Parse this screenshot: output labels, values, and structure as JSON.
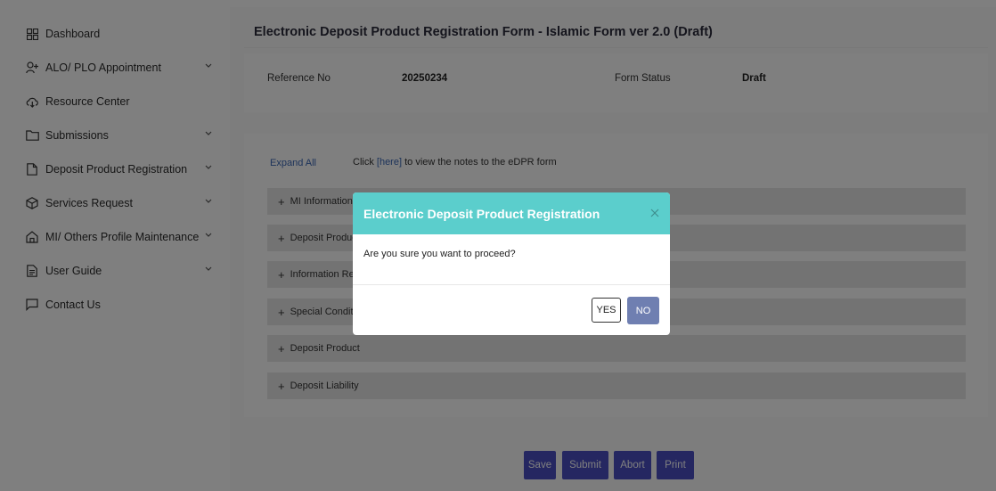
{
  "sidebar": {
    "items": [
      {
        "label": "Dashboard",
        "icon": "grid-icon",
        "has_chevron": false
      },
      {
        "label": "ALO/ PLO Appointment",
        "icon": "add-user-icon",
        "has_chevron": true
      },
      {
        "label": "Resource Center",
        "icon": "cloud-icon",
        "has_chevron": false
      },
      {
        "label": "Submissions",
        "icon": "folder-icon",
        "has_chevron": true
      },
      {
        "label": "Deposit Product Registration",
        "icon": "document-icon",
        "has_chevron": true
      },
      {
        "label": "Services Request",
        "icon": "box-icon",
        "has_chevron": true
      },
      {
        "label": "MI/ Others Profile Maintenance",
        "icon": "home-icon",
        "has_chevron": true
      },
      {
        "label": "User Guide",
        "icon": "guide-icon",
        "has_chevron": true
      },
      {
        "label": "Contact Us",
        "icon": "chat-icon",
        "has_chevron": false
      }
    ]
  },
  "header": {
    "title": "Electronic Deposit Product Registration Form - Islamic Form ver 2.0 (Draft)"
  },
  "info": {
    "reference_label": "Reference No",
    "reference_value": "20250234",
    "status_label": "Form Status",
    "status_value": "Draft"
  },
  "form": {
    "expand_all": "Expand All",
    "notes_prefix": "Click ",
    "notes_link": "[here]",
    "notes_suffix": " to view the notes to the eDPR form",
    "sections": [
      "MI Information",
      "Deposit Product",
      "Information Rel",
      "Special Conditic",
      "Deposit Product",
      "Deposit Liability"
    ]
  },
  "actions": {
    "save": "Save",
    "submit": "Submit",
    "abort": "Abort",
    "print": "Print"
  },
  "modal": {
    "title": "Electronic Deposit Product Registration",
    "message": "Are you sure you want to proceed?",
    "yes": "YES",
    "no": "NO"
  },
  "colors": {
    "modal_header": "#5bcecc",
    "action_button": "#4b4fc3",
    "no_button": "#6f7fb1",
    "link": "#3b67b5"
  }
}
